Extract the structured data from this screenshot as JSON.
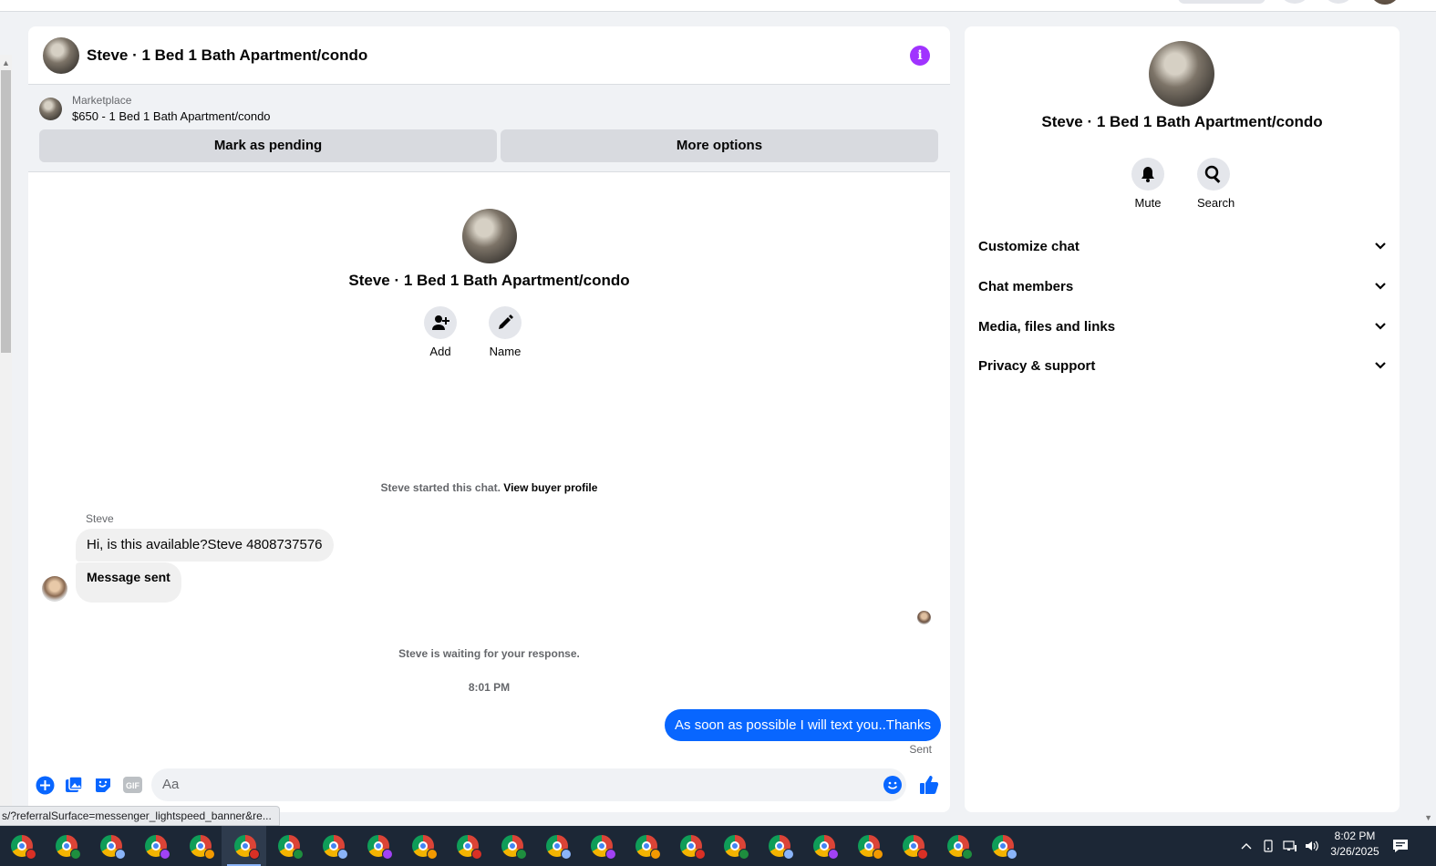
{
  "chat": {
    "title": "Steve · 1 Bed 1 Bath Apartment/condo",
    "marketplace": {
      "label": "Marketplace",
      "item": "$650 - 1 Bed 1 Bath Apartment/condo",
      "pending_button": "Mark as pending",
      "more_button": "More options"
    },
    "intro": {
      "name": "Steve · 1 Bed 1 Bath Apartment/condo",
      "add_label": "Add",
      "name_label": "Name"
    },
    "started_text": "Steve started this chat.",
    "buyer_profile_link": "View buyer profile",
    "messages": {
      "sender": "Steve",
      "incoming_1": "Hi, is this available?Steve 4808737576",
      "incoming_2": "Message sent",
      "waiting": "Steve is waiting for your response.",
      "time": "8:01 PM",
      "outgoing": "As soon as possible I will text you..Thanks",
      "status": "Sent"
    },
    "composer": {
      "placeholder": "Aa"
    }
  },
  "side": {
    "name": "Steve · 1 Bed 1 Bath Apartment/condo",
    "mute_label": "Mute",
    "search_label": "Search",
    "sections": [
      "Customize chat",
      "Chat members",
      "Media, files and links",
      "Privacy & support"
    ]
  },
  "status_url": "s/?referralSurface=messenger_lightspeed_banner&re...",
  "taskbar": {
    "time": "8:02 PM",
    "date": "3/26/2025",
    "app_count": 23,
    "badge_colors": [
      "#d93025",
      "#1e8e3e",
      "#8ab4f8",
      "#a142f4",
      "#f29900"
    ]
  },
  "colors": {
    "accent": "#0866ff",
    "info": "#a033ff"
  }
}
